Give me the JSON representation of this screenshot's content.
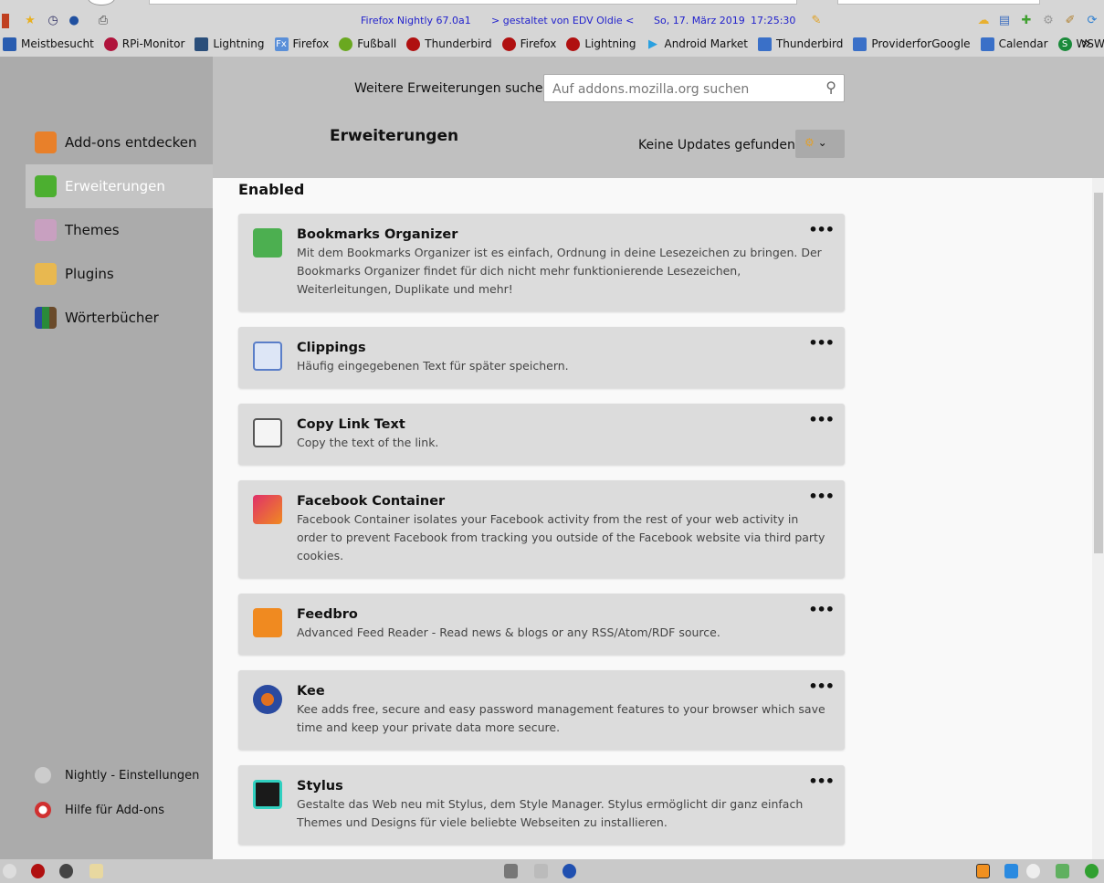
{
  "toolbar": {
    "app_version": "Firefox Nightly 67.0a1",
    "designer": "> gestaltet von EDV Oldie <",
    "date": "So, 17. März 2019",
    "time": "17:25:30"
  },
  "bookmarks": [
    {
      "label": "Meistbesucht",
      "color": "#2a5db0"
    },
    {
      "label": "RPi-Monitor",
      "color": "#b0143c"
    },
    {
      "label": "Lightning",
      "color": "#2a4e7a"
    },
    {
      "label": "Firefox",
      "color": "#5a8fd8"
    },
    {
      "label": "Fußball",
      "color": "#6aa820"
    },
    {
      "label": "Thunderbird",
      "color": "#b01010"
    },
    {
      "label": "Firefox",
      "color": "#b01010"
    },
    {
      "label": "Lightning",
      "color": "#b01010"
    },
    {
      "label": "Android Market",
      "color": "#2aa0e0"
    },
    {
      "label": "Thunderbird",
      "color": "#3a70c8"
    },
    {
      "label": "ProviderforGoogle",
      "color": "#3a70c8"
    },
    {
      "label": "Calendar",
      "color": "#3a70c8"
    },
    {
      "label": "WSW",
      "color": "#1a8a3a"
    }
  ],
  "bookmarks_overflow": "»",
  "sidebar": {
    "items": [
      {
        "label": "Add-ons entdecken",
        "color": "#e8802a"
      },
      {
        "label": "Erweiterungen",
        "color": "#4caf30"
      },
      {
        "label": "Themes",
        "color": "#c8a0c0"
      },
      {
        "label": "Plugins",
        "color": "#e8b850"
      },
      {
        "label": "Wörterbücher",
        "color": "#6a4a2a"
      }
    ],
    "footer": [
      {
        "label": "Nightly - Einstellungen"
      },
      {
        "label": "Hilfe für Add-ons"
      }
    ]
  },
  "header": {
    "search_label": "Weitere Erweiterungen suchen",
    "search_placeholder": "Auf addons.mozilla.org suchen",
    "title": "Erweiterungen",
    "update_status": "Keine Updates gefunden"
  },
  "section_title": "Enabled",
  "more_label": "•••",
  "addons": [
    {
      "name": "Bookmarks Organizer",
      "description": "Mit dem Bookmarks Organizer ist es einfach, Ordnung in deine Lesezeichen zu bringen. Der Bookmarks Organizer findet für dich nicht mehr funktionierende Lesezeichen, Weiterleitungen, Duplikate und mehr!",
      "color": "#4caf50"
    },
    {
      "name": "Clippings",
      "description": "Häufig eingegebenen Text für später speichern.",
      "color": "#5a7ec8"
    },
    {
      "name": "Copy Link Text",
      "description": "Copy the text of the link.",
      "color": "#888888"
    },
    {
      "name": "Facebook Container",
      "description": "Facebook Container isolates your Facebook activity from the rest of your web activity in order to prevent Facebook from tracking you outside of the Facebook website via third party cookies.",
      "color": "#e0306a"
    },
    {
      "name": "Feedbro",
      "description": "Advanced Feed Reader - Read news & blogs or any RSS/Atom/RDF source.",
      "color": "#f08a20"
    },
    {
      "name": "Kee",
      "description": "Kee adds free, secure and easy password management features to your browser which save time and keep your private data more secure.",
      "color": "#2a4aa0"
    },
    {
      "name": "Stylus",
      "description": "Gestalte das Web neu mit Stylus, dem Style Manager. Stylus ermöglicht dir ganz einfach Themes und Designs für viele beliebte Webseiten zu installieren.",
      "color": "#1a1a1a"
    }
  ]
}
